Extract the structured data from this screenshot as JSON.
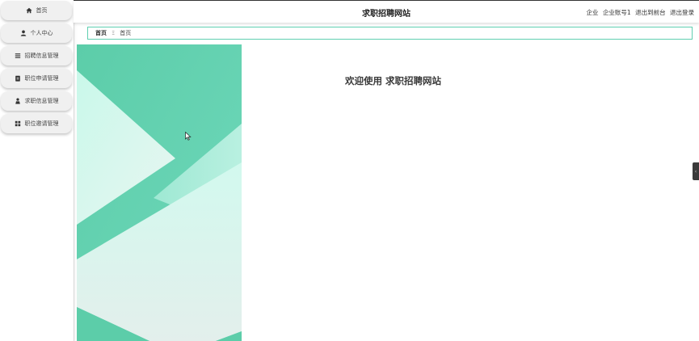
{
  "sidebar": {
    "items": [
      {
        "label": "首页",
        "icon": "home-icon"
      },
      {
        "label": "个人中心",
        "icon": "user-icon"
      },
      {
        "label": "招聘信息管理",
        "icon": "list-icon"
      },
      {
        "label": "职位申请管理",
        "icon": "clipboard-icon"
      },
      {
        "label": "求职信息管理",
        "icon": "person-icon"
      },
      {
        "label": "职位邀请管理",
        "icon": "grid-icon"
      }
    ]
  },
  "header": {
    "title": "求职招聘网站",
    "role": "企业",
    "account": "企业账号1",
    "back_to_front": "退出到前台",
    "logout": "退出登录"
  },
  "breadcrumb": {
    "home": "首页",
    "separator": "Ξ",
    "current": "首页"
  },
  "main": {
    "welcome": "欢迎使用 求职招聘网站"
  },
  "side_tab": {
    "icon": "chevron-left-icon",
    "glyph": "‹"
  },
  "colors": {
    "accent": "#5fcfb0",
    "banner_dark": "#5ccda9",
    "banner_light": "#c8f7ea",
    "sidebar_item_bg": "#f0f0f0"
  }
}
